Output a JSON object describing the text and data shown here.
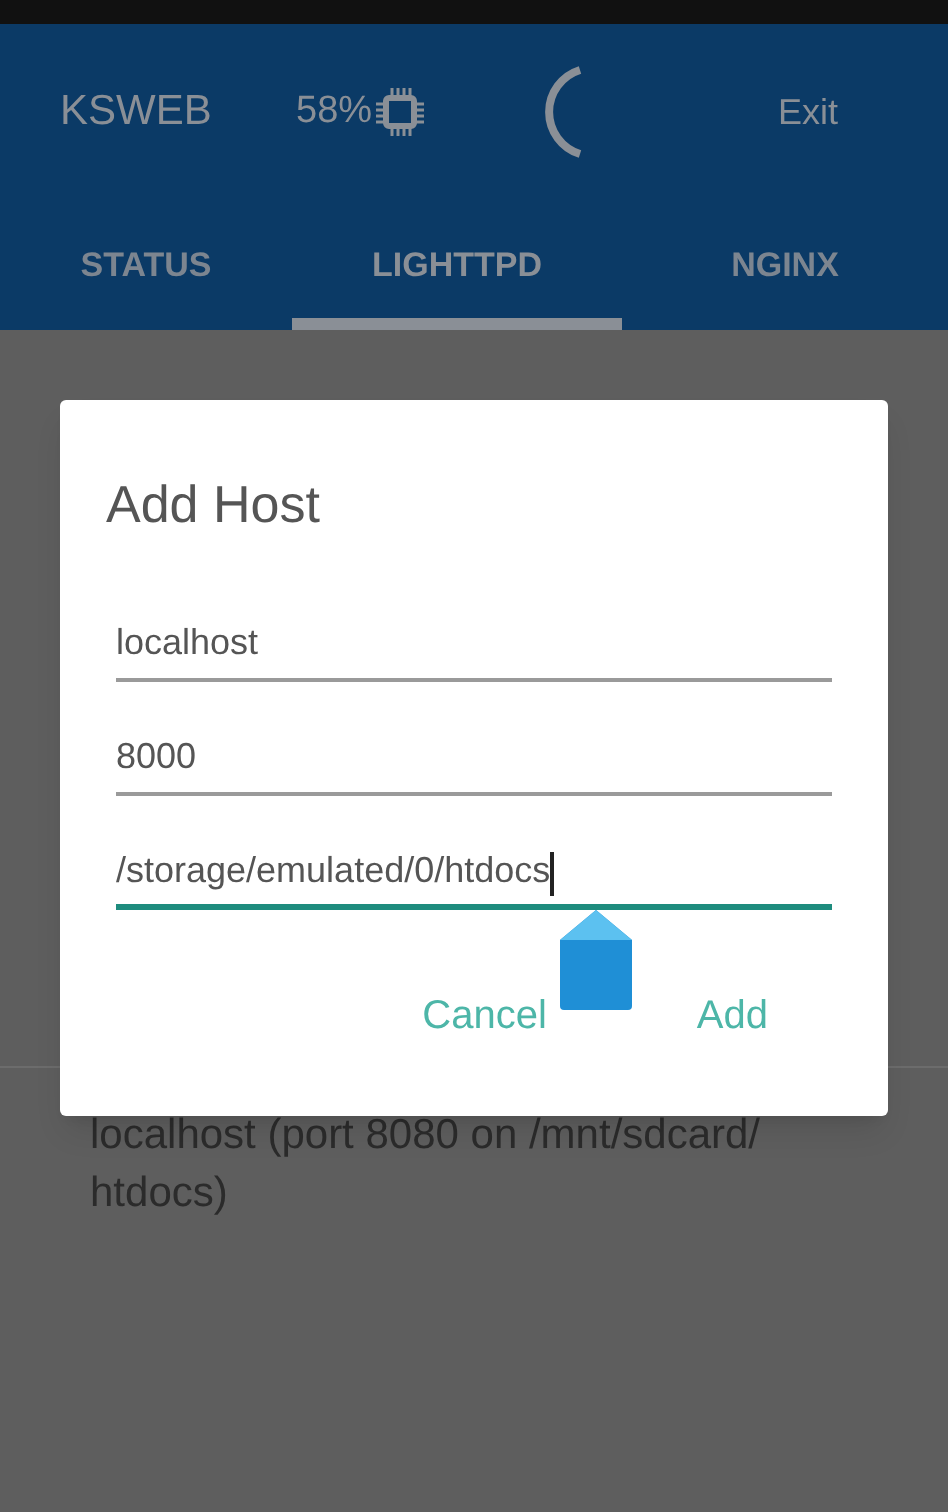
{
  "app_bar": {
    "title": "KSWEB",
    "cpu_usage": "58%",
    "exit": "Exit"
  },
  "tabs": [
    {
      "label": "STATUS",
      "selected": false
    },
    {
      "label": "LIGHTTPD",
      "selected": true
    },
    {
      "label": "NGINX",
      "selected": false
    }
  ],
  "hosts": [
    {
      "text": "localhost (port 8080 on /mnt/sdcard/ htdocs)"
    }
  ],
  "dialog": {
    "title": "Add Host",
    "fields": [
      {
        "value": "localhost",
        "focused": false
      },
      {
        "value": "8000",
        "focused": false
      },
      {
        "value": "/storage/emulated/0/htdocs",
        "focused": true
      }
    ],
    "buttons": [
      "Cancel",
      "Add"
    ]
  }
}
